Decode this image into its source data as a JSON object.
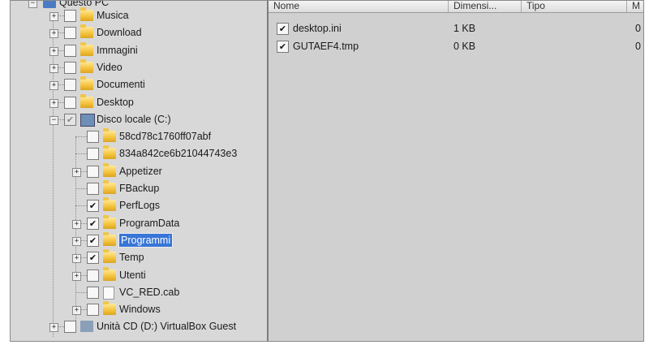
{
  "tree": {
    "root_label": "Questo PC",
    "items": [
      {
        "label": "Musica",
        "expander": "+",
        "checked": false,
        "icon": "music-folder-icon"
      },
      {
        "label": "Download",
        "expander": "+",
        "checked": false,
        "icon": "download-folder-icon"
      },
      {
        "label": "Immagini",
        "expander": "+",
        "checked": false,
        "icon": "pictures-folder-icon"
      },
      {
        "label": "Video",
        "expander": "+",
        "checked": false,
        "icon": "video-folder-icon"
      },
      {
        "label": "Documenti",
        "expander": "+",
        "checked": false,
        "icon": "documents-folder-icon"
      },
      {
        "label": "Desktop",
        "expander": "+",
        "checked": false,
        "icon": "desktop-folder-icon"
      },
      {
        "label": "Disco locale (C:)",
        "expander": "−",
        "checked": "partial",
        "icon": "drive-icon"
      },
      {
        "label": "58cd78c1760ff07abf",
        "expander": "",
        "checked": false,
        "icon": "folder-icon"
      },
      {
        "label": "834a842ce6b21044743e3",
        "expander": "",
        "checked": false,
        "icon": "folder-icon"
      },
      {
        "label": "Appetizer",
        "expander": "+",
        "checked": false,
        "icon": "folder-icon"
      },
      {
        "label": "FBackup",
        "expander": "",
        "checked": false,
        "icon": "folder-icon"
      },
      {
        "label": "PerfLogs",
        "expander": "",
        "checked": true,
        "icon": "folder-icon"
      },
      {
        "label": "ProgramData",
        "expander": "+",
        "checked": true,
        "icon": "folder-icon"
      },
      {
        "label": "Programmi",
        "expander": "+",
        "checked": true,
        "icon": "folder-icon",
        "selected": true
      },
      {
        "label": "Temp",
        "expander": "+",
        "checked": true,
        "icon": "folder-icon"
      },
      {
        "label": "Utenti",
        "expander": "+",
        "checked": false,
        "icon": "folder-icon"
      },
      {
        "label": "VC_RED.cab",
        "expander": "",
        "checked": false,
        "icon": "file-icon"
      },
      {
        "label": "Windows",
        "expander": "+",
        "checked": false,
        "icon": "folder-icon"
      },
      {
        "label": "Unità CD (D:) VirtualBox Guest",
        "expander": "+",
        "checked": false,
        "icon": "cd-drive-icon"
      }
    ]
  },
  "list": {
    "columns": [
      "Nome",
      "Dimensi...",
      "Tipo",
      "M"
    ],
    "rows": [
      {
        "name": "desktop.ini",
        "size": "1 KB",
        "type": "",
        "modified": "0",
        "checked": true
      },
      {
        "name": "GUTAEF4.tmp",
        "size": "0 KB",
        "type": "",
        "modified": "0",
        "checked": true
      }
    ]
  },
  "colors": {
    "selection": "#3875d7",
    "folder": "#f4c23a",
    "pane_bg": "#d0d0d0"
  }
}
